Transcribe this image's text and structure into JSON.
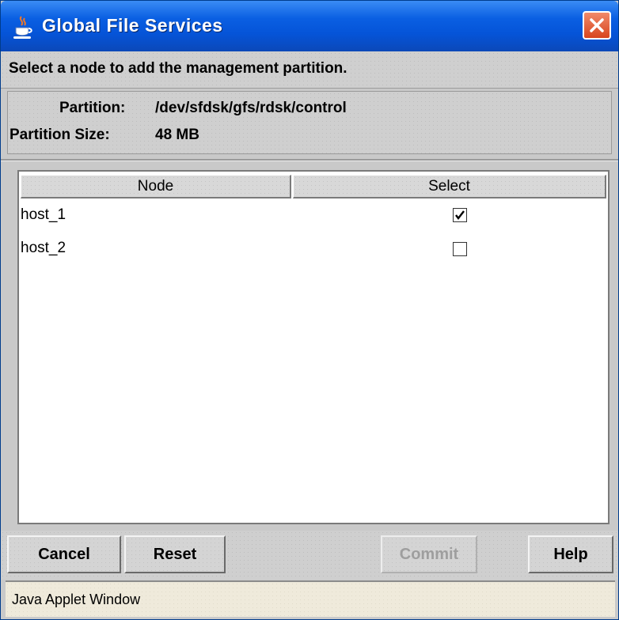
{
  "window": {
    "title": "Global File Services",
    "icon": "java-cup-icon",
    "close_icon": "close-icon"
  },
  "instruction": "Select a node to add the management partition.",
  "info": {
    "partition_label": "Partition:",
    "partition_value": "/dev/sfdsk/gfs/rdsk/control",
    "size_label": "Partition Size:",
    "size_value": "48 MB"
  },
  "table": {
    "columns": [
      "Node",
      "Select"
    ],
    "rows": [
      {
        "node": "host_1",
        "selected": true
      },
      {
        "node": "host_2",
        "selected": false
      }
    ]
  },
  "buttons": {
    "cancel": "Cancel",
    "reset": "Reset",
    "commit": "Commit",
    "help": "Help"
  },
  "status": "Java Applet Window",
  "colors": {
    "titlebar": "#0554d8",
    "close": "#d8451d",
    "status_bg": "#efeadb"
  }
}
